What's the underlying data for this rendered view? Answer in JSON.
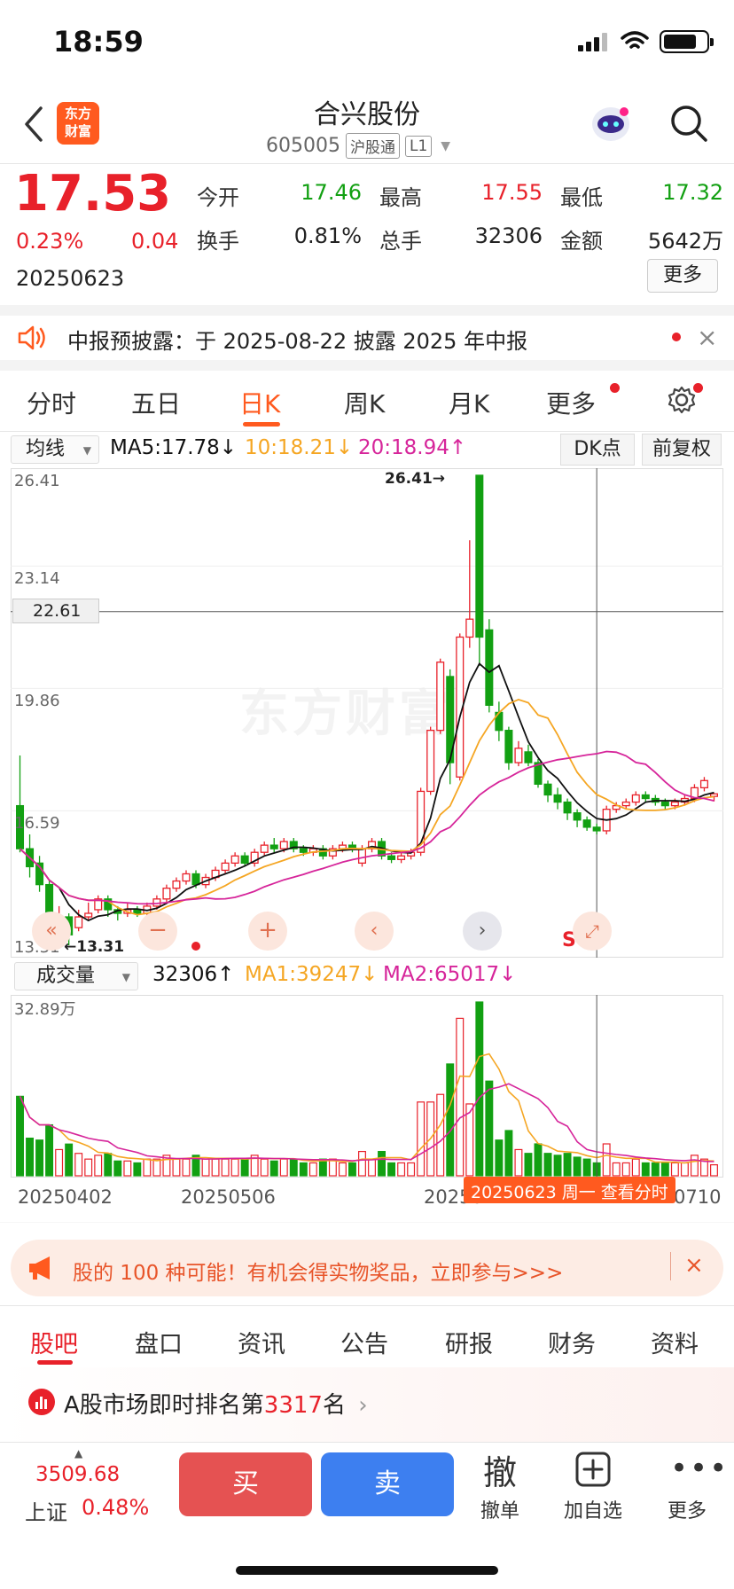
{
  "status": {
    "time": "18:59"
  },
  "header": {
    "logo_text": "东方财富",
    "stock_name": "合兴股份",
    "stock_code": "605005",
    "tags": [
      "沪股通",
      "L1"
    ]
  },
  "quote": {
    "price": "17.53",
    "change_pct": "0.23%",
    "change": "0.04",
    "date": "20250623",
    "open_label": "今开",
    "open": "17.46",
    "high_label": "最高",
    "high": "17.55",
    "low_label": "最低",
    "low": "17.32",
    "turnover_label": "换手",
    "turnover": "0.81%",
    "volume_label": "总手",
    "volume": "32306",
    "amount_label": "金额",
    "amount": "5642万",
    "more_label": "更多"
  },
  "notice": {
    "text": "中报预披露：于 2025-08-22 披露 2025 年中报",
    "close": "×"
  },
  "kline_tabs": [
    "分时",
    "五日",
    "日K",
    "周K",
    "月K",
    "更多"
  ],
  "kline_active": "日K",
  "ma_row": {
    "select": "均线",
    "ma5": "MA5:17.78↓",
    "ma10": "10:18.21↓",
    "ma20": "20:18.94↑",
    "dk": "DK点",
    "fq": "前复权"
  },
  "colors": {
    "up": "#e8212a",
    "down": "#12a012",
    "ma5": "#111111",
    "ma10": "#f5a623",
    "ma20": "#d6259a",
    "accent": "#ff5a1f"
  },
  "chart_data": {
    "type": "candlestick",
    "y_ticks": [
      "26.41",
      "23.14",
      "19.86",
      "16.59",
      "13.31"
    ],
    "ylim": [
      13.31,
      26.41
    ],
    "crosshair_value": "22.61",
    "max_label": "26.41→",
    "min_label": "←13.31",
    "watermark": "东方财富",
    "candles": [
      {
        "o": 17.2,
        "c": 16.0,
        "h": 18.6,
        "l": 15.9
      },
      {
        "o": 16.0,
        "c": 15.5,
        "h": 16.4,
        "l": 15.2
      },
      {
        "o": 15.6,
        "c": 15.0,
        "h": 15.8,
        "l": 14.8
      },
      {
        "o": 15.0,
        "c": 14.0,
        "h": 15.1,
        "l": 13.7
      },
      {
        "o": 13.8,
        "c": 14.1,
        "h": 14.4,
        "l": 13.6
      },
      {
        "o": 14.1,
        "c": 13.6,
        "h": 14.2,
        "l": 13.31
      },
      {
        "o": 13.8,
        "c": 14.1,
        "h": 14.3,
        "l": 13.7
      },
      {
        "o": 14.1,
        "c": 14.2,
        "h": 14.5,
        "l": 14.0
      },
      {
        "o": 14.3,
        "c": 14.6,
        "h": 14.7,
        "l": 14.2
      },
      {
        "o": 14.6,
        "c": 14.3,
        "h": 14.7,
        "l": 14.1
      },
      {
        "o": 14.3,
        "c": 14.2,
        "h": 14.4,
        "l": 14.0
      },
      {
        "o": 14.2,
        "c": 14.3,
        "h": 14.5,
        "l": 14.1
      },
      {
        "o": 14.3,
        "c": 14.2,
        "h": 14.4,
        "l": 14.1
      },
      {
        "o": 14.2,
        "c": 14.4,
        "h": 14.5,
        "l": 14.1
      },
      {
        "o": 14.4,
        "c": 14.6,
        "h": 14.7,
        "l": 14.3
      },
      {
        "o": 14.6,
        "c": 14.9,
        "h": 15.0,
        "l": 14.5
      },
      {
        "o": 14.9,
        "c": 15.1,
        "h": 15.2,
        "l": 14.8
      },
      {
        "o": 15.1,
        "c": 15.3,
        "h": 15.4,
        "l": 15.0
      },
      {
        "o": 15.3,
        "c": 15.0,
        "h": 15.4,
        "l": 14.9
      },
      {
        "o": 15.0,
        "c": 15.2,
        "h": 15.3,
        "l": 14.9
      },
      {
        "o": 15.2,
        "c": 15.4,
        "h": 15.5,
        "l": 15.1
      },
      {
        "o": 15.4,
        "c": 15.6,
        "h": 15.7,
        "l": 15.3
      },
      {
        "o": 15.6,
        "c": 15.8,
        "h": 15.9,
        "l": 15.5
      },
      {
        "o": 15.8,
        "c": 15.6,
        "h": 15.9,
        "l": 15.5
      },
      {
        "o": 15.6,
        "c": 15.9,
        "h": 16.0,
        "l": 15.5
      },
      {
        "o": 15.9,
        "c": 16.1,
        "h": 16.2,
        "l": 15.8
      },
      {
        "o": 16.1,
        "c": 16.0,
        "h": 16.3,
        "l": 15.9
      },
      {
        "o": 16.0,
        "c": 16.2,
        "h": 16.3,
        "l": 15.9
      },
      {
        "o": 16.2,
        "c": 16.0,
        "h": 16.3,
        "l": 15.9
      },
      {
        "o": 16.0,
        "c": 15.9,
        "h": 16.1,
        "l": 15.8
      },
      {
        "o": 15.9,
        "c": 16.0,
        "h": 16.1,
        "l": 15.8
      },
      {
        "o": 16.0,
        "c": 15.8,
        "h": 16.1,
        "l": 15.7
      },
      {
        "o": 15.8,
        "c": 16.0,
        "h": 16.1,
        "l": 15.7
      },
      {
        "o": 16.0,
        "c": 16.1,
        "h": 16.2,
        "l": 15.9
      },
      {
        "o": 16.1,
        "c": 16.0,
        "h": 16.2,
        "l": 15.9
      },
      {
        "o": 15.6,
        "c": 16.0,
        "h": 16.1,
        "l": 15.5
      },
      {
        "o": 16.0,
        "c": 16.2,
        "h": 16.3,
        "l": 15.9
      },
      {
        "o": 16.2,
        "c": 15.8,
        "h": 16.3,
        "l": 15.7
      },
      {
        "o": 15.8,
        "c": 15.7,
        "h": 15.9,
        "l": 15.6
      },
      {
        "o": 15.7,
        "c": 15.8,
        "h": 15.9,
        "l": 15.6
      },
      {
        "o": 15.8,
        "c": 15.9,
        "h": 16.0,
        "l": 15.7
      },
      {
        "o": 15.9,
        "c": 17.6,
        "h": 17.7,
        "l": 15.8
      },
      {
        "o": 17.6,
        "c": 19.3,
        "h": 19.4,
        "l": 17.5
      },
      {
        "o": 19.3,
        "c": 21.2,
        "h": 21.3,
        "l": 19.2
      },
      {
        "o": 20.8,
        "c": 18.4,
        "h": 21.0,
        "l": 17.8
      },
      {
        "o": 18.0,
        "c": 21.9,
        "h": 22.0,
        "l": 17.9
      },
      {
        "o": 21.9,
        "c": 22.4,
        "h": 24.6,
        "l": 21.6
      },
      {
        "o": 26.41,
        "c": 21.9,
        "h": 26.41,
        "l": 21.1
      },
      {
        "o": 22.1,
        "c": 20.0,
        "h": 22.4,
        "l": 19.8
      },
      {
        "o": 19.8,
        "c": 19.3,
        "h": 20.1,
        "l": 19.0
      },
      {
        "o": 19.3,
        "c": 18.4,
        "h": 19.4,
        "l": 18.2
      },
      {
        "o": 18.4,
        "c": 18.8,
        "h": 19.0,
        "l": 18.3
      },
      {
        "o": 18.7,
        "c": 18.4,
        "h": 18.9,
        "l": 18.3
      },
      {
        "o": 18.4,
        "c": 17.8,
        "h": 18.5,
        "l": 17.7
      },
      {
        "o": 17.8,
        "c": 17.5,
        "h": 17.9,
        "l": 17.3
      },
      {
        "o": 17.5,
        "c": 17.3,
        "h": 17.7,
        "l": 17.1
      },
      {
        "o": 17.3,
        "c": 17.0,
        "h": 17.4,
        "l": 16.8
      },
      {
        "o": 17.0,
        "c": 16.8,
        "h": 17.1,
        "l": 16.6
      },
      {
        "o": 16.8,
        "c": 16.6,
        "h": 16.9,
        "l": 16.5
      },
      {
        "o": 16.6,
        "c": 16.5,
        "h": 16.7,
        "l": 16.4
      },
      {
        "o": 16.5,
        "c": 17.1,
        "h": 17.2,
        "l": 16.4
      },
      {
        "o": 17.1,
        "c": 17.2,
        "h": 17.3,
        "l": 17.0
      },
      {
        "o": 17.2,
        "c": 17.3,
        "h": 17.4,
        "l": 17.1
      },
      {
        "o": 17.3,
        "c": 17.5,
        "h": 17.6,
        "l": 17.2
      },
      {
        "o": 17.5,
        "c": 17.4,
        "h": 17.6,
        "l": 17.3
      },
      {
        "o": 17.4,
        "c": 17.3,
        "h": 17.5,
        "l": 17.2
      },
      {
        "o": 17.3,
        "c": 17.2,
        "h": 17.4,
        "l": 17.1
      },
      {
        "o": 17.2,
        "c": 17.3,
        "h": 17.4,
        "l": 17.1
      },
      {
        "o": 17.3,
        "c": 17.4,
        "h": 17.5,
        "l": 17.2
      },
      {
        "o": 17.4,
        "c": 17.7,
        "h": 17.8,
        "l": 17.3
      },
      {
        "o": 17.7,
        "c": 17.9,
        "h": 18.0,
        "l": 17.6
      },
      {
        "o": 17.46,
        "c": 17.53,
        "h": 17.55,
        "l": 17.32
      }
    ],
    "volume": {
      "select": "成交量",
      "value": "32306↑",
      "ma1": "MA1:39247↓",
      "ma2": "MA2:65017↓",
      "max_label": "32.89万",
      "max": 32.89
    },
    "x_dates": [
      "20250402",
      "20250506",
      "20250",
      "0710"
    ],
    "badge": "20250623 周一 查看分时"
  },
  "promo": {
    "text": "股的 100 种可能！有机会得实物奖品，立即参与>>>",
    "close": "×"
  },
  "bottom_tabs": [
    "股吧",
    "盘口",
    "资讯",
    "公告",
    "研报",
    "财务",
    "资料"
  ],
  "bottom_tab_active": "股吧",
  "rank": {
    "prefix": "A股市场即时排名第",
    "num": "3317",
    "suffix": "名"
  },
  "bottom_bar": {
    "index_value": "3509.68",
    "index_name": "上证",
    "index_pct": "0.48%",
    "buy": "买",
    "sell": "卖",
    "cancel_icon": "撤",
    "cancel": "撤单",
    "add": "加自选",
    "more": "更多"
  }
}
